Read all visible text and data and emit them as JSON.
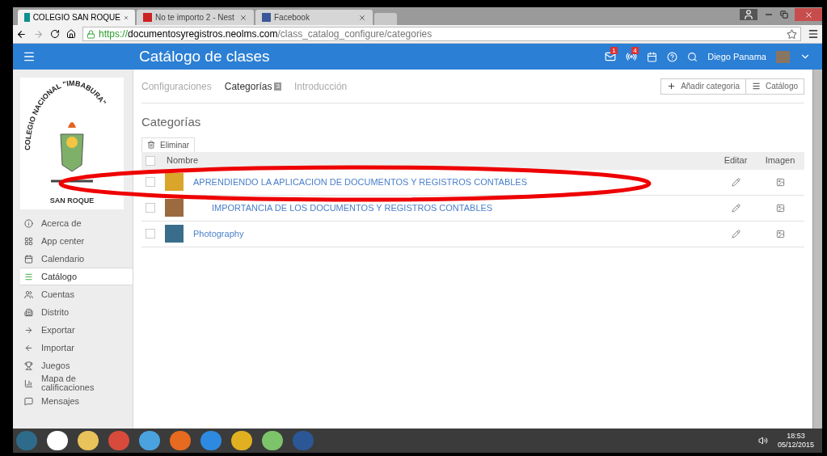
{
  "browser": {
    "tabs": [
      {
        "title": "COLEGIO SAN ROQUE",
        "selected": true
      },
      {
        "title": "No te importo 2 - Nest",
        "selected": false
      },
      {
        "title": "Facebook",
        "selected": false
      }
    ],
    "url_host": "https://documentosyregistros.neolms.com",
    "url_path": "/class_catalog_configure/categories"
  },
  "header": {
    "title": "Catálogo de clases",
    "mail_badge": "1",
    "alerts_badge": "4",
    "user": "Diego Panama"
  },
  "sidebar": {
    "logo": {
      "arc": "COLEGIO NACIONAL \"IMBABURA\"",
      "caption": "SAN ROQUE"
    },
    "items": [
      {
        "label": "Acerca de",
        "selected": false
      },
      {
        "label": "App center",
        "selected": false
      },
      {
        "label": "Calendario",
        "selected": false
      },
      {
        "label": "Catálogo",
        "selected": true
      },
      {
        "label": "Cuentas",
        "selected": false
      },
      {
        "label": "Distrito",
        "selected": false
      },
      {
        "label": "Exportar",
        "selected": false
      },
      {
        "label": "Importar",
        "selected": false
      },
      {
        "label": "Juegos",
        "selected": false
      },
      {
        "label": "Mapa de calificaciones",
        "selected": false
      },
      {
        "label": "Mensajes",
        "selected": false
      }
    ]
  },
  "page": {
    "tabs": [
      {
        "label": "Configuraciones",
        "selected": false
      },
      {
        "label": "Categorías",
        "count": "3",
        "selected": true
      },
      {
        "label": "Introducción",
        "selected": false
      }
    ],
    "actions": [
      "Añadir categoria",
      "Catálogo"
    ],
    "heading": "Categorías",
    "delete_button": "Eliminar",
    "all_checked": false,
    "table": {
      "columns": [
        "Nombre",
        "Editar",
        "Imagen"
      ],
      "rows": [
        {
          "name": "APRENDIENDO LA APLICACION DE DOCUMENTOS Y REGISTROS CONTABLES",
          "checked": false,
          "children": [
            {
              "name": "IMPORTANCIA DE LOS DOCUMENTOS Y REGISTROS CONTABLES",
              "checked": false
            }
          ]
        },
        {
          "name": "Photography",
          "checked": false
        }
      ]
    }
  },
  "taskbar": {
    "time": "18:53",
    "date": "05/12/2015"
  }
}
